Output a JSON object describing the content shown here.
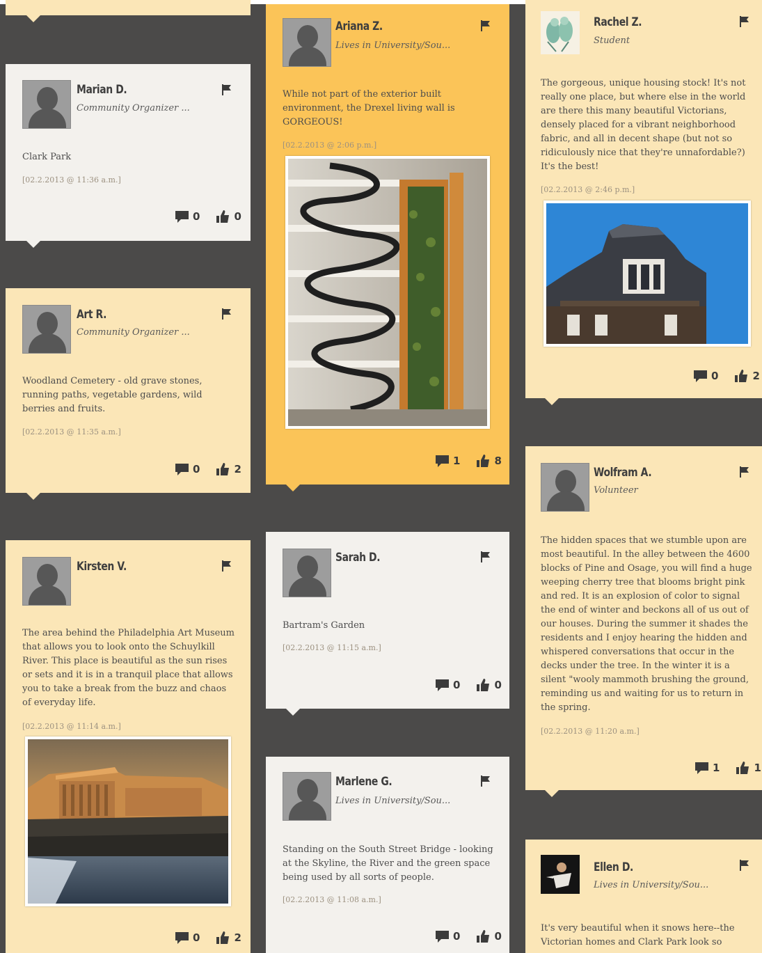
{
  "stats_icons": {
    "comment": "comment-icon",
    "like": "thumbs-up-icon"
  },
  "posts": {
    "marian": {
      "name": "Marian D.",
      "role": "Community Organizer ...",
      "text": "Clark Park",
      "timestamp": "[02.2.2013 @ 11:36 a.m.]",
      "comments": "0",
      "likes": "0"
    },
    "art": {
      "name": "Art R.",
      "role": "Community Organizer ...",
      "text": "Woodland Cemetery - old grave stones, running paths, vegetable gardens, wild berries and fruits.",
      "timestamp": "[02.2.2013 @ 11:35 a.m.]",
      "comments": "0",
      "likes": "2"
    },
    "kirsten": {
      "name": "Kirsten V.",
      "role": "",
      "text": "The area behind the Philadelphia Art Museum that allows you to look onto the Schuylkill River. This place is beautiful as the sun rises or sets and it is in a tranquil place that allows you to take a break from the buzz and chaos of everyday life.",
      "timestamp": "[02.2.2013 @ 11:14 a.m.]",
      "comments": "0",
      "likes": "2"
    },
    "ariana": {
      "name": "Ariana Z.",
      "role": "Lives in University/Sou...",
      "text": "While not part of the exterior built environment, the Drexel living wall is GORGEOUS!",
      "timestamp": "[02.2.2013 @ 2:06 p.m.]",
      "comments": "1",
      "likes": "8"
    },
    "sarah": {
      "name": "Sarah D.",
      "role": "",
      "text": "Bartram's Garden",
      "timestamp": "[02.2.2013 @ 11:15 a.m.]",
      "comments": "0",
      "likes": "0"
    },
    "marlene": {
      "name": "Marlene G.",
      "role": "Lives in University/Sou...",
      "text": "Standing on the South Street Bridge - looking at the Skyline, the River and the green space being used by all sorts of people.",
      "timestamp": "[02.2.2013 @ 11:08 a.m.]",
      "comments": "0",
      "likes": "0"
    },
    "rachel": {
      "name": "Rachel Z.",
      "role": "Student",
      "text": "The gorgeous, unique housing stock! It's not really one place, but where else in the world are there this many beautiful Victorians, densely placed for a vibrant neighborhood fabric, and all in decent shape (but not so ridiculously nice that they're unnafordable?) It's the best!",
      "timestamp": "[02.2.2013 @ 2:46 p.m.]",
      "comments": "0",
      "likes": "2"
    },
    "wolfram": {
      "name": "Wolfram A.",
      "role": "Volunteer",
      "text": "The hidden spaces that we stumble upon are most beautiful. In the alley between the 4600 blocks of Pine and Osage, you will find a huge weeping cherry tree that blooms bright pink and red. It is an explosion of color to signal the end of winter and beckons all of us out of our houses. During the summer it shades the residents and I enjoy hearing the hidden and whispered conversations that occur in the decks under the tree. In the winter it is a silent \"wooly mammoth brushing the ground, reminding us and waiting for us to return in the spring.",
      "timestamp": "[02.2.2013 @ 11:20 a.m.]",
      "comments": "1",
      "likes": "1"
    },
    "ellen": {
      "name": "Ellen D.",
      "role": "Lives in University/Sou...",
      "text": "It's very beautiful when it snows here--the Victorian homes and Clark Park look so"
    }
  },
  "colors": {
    "background": "#4b4a49",
    "card_white": "#f3f1ed",
    "card_cream": "#fbe6b7",
    "card_yellow": "#fbc458"
  }
}
